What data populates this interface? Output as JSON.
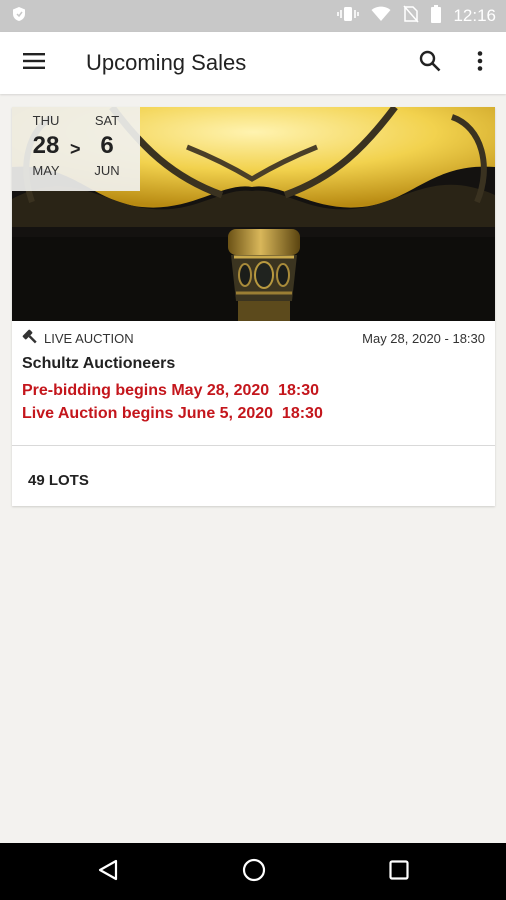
{
  "status_bar": {
    "time": "12:16",
    "icons": [
      "shield-icon",
      "vibrate-icon",
      "wifi-icon",
      "no-sim-icon",
      "battery-icon"
    ]
  },
  "app_bar": {
    "title": "Upcoming Sales",
    "icons": [
      "menu-icon",
      "search-icon",
      "more-vert-icon"
    ]
  },
  "sale": {
    "start": {
      "dow": "THU",
      "day": "28",
      "month": "MAY"
    },
    "separator": ">",
    "end": {
      "dow": "SAT",
      "day": "6",
      "month": "JUN"
    },
    "type_icon": "gavel-icon",
    "type": "LIVE AUCTION",
    "datetime": "May 28, 2020 - 18:30",
    "auctioneer": "Schultz Auctioneers",
    "prebid": "Pre-bidding begins May 28, 2020  18:30",
    "live": "Live Auction begins June 5, 2020  18:30",
    "lots": "49 LOTS"
  },
  "nav_bar": {
    "icons": [
      "back-icon",
      "home-icon",
      "recents-icon"
    ]
  },
  "colors": {
    "accent_red": "#c4161c",
    "status_bar": "#c8c8c8",
    "background": "#f3f2ef"
  }
}
